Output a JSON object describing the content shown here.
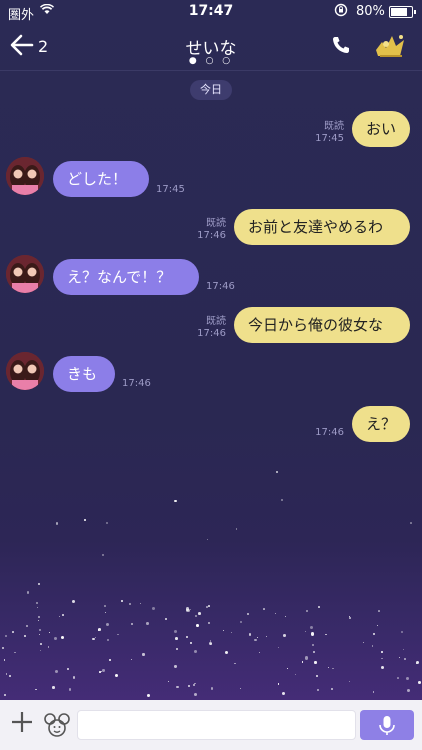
{
  "status_bar": {
    "carrier": "圏外",
    "time": "17:47",
    "battery_percent": "80%",
    "battery_level": 0.8,
    "icons": [
      "wifi-icon",
      "rotation-lock-icon",
      "battery-icon"
    ]
  },
  "header": {
    "back_count": "2",
    "title": "せいな",
    "page_dots": "● ○ ○",
    "icons": [
      "back-arrow-icon",
      "phone-icon",
      "profile-avatar"
    ]
  },
  "date_chip": "今日",
  "messages": [
    {
      "side": "right",
      "text": "おい",
      "read": "既読",
      "time": "17:45"
    },
    {
      "side": "left",
      "text": "どした！",
      "time": "17:45"
    },
    {
      "side": "right",
      "text": "お前と友達やめるわ",
      "read": "既読",
      "time": "17:46"
    },
    {
      "side": "left",
      "text": "え？なんで！？",
      "time": "17:46"
    },
    {
      "side": "right",
      "text": "今日から俺の彼女な",
      "read": "既読",
      "time": "17:46"
    },
    {
      "side": "left",
      "text": "きも",
      "time": "17:46"
    },
    {
      "side": "right",
      "text": "え？",
      "time": "17:46"
    }
  ],
  "input_bar": {
    "placeholder": "",
    "icons": [
      "plus-icon",
      "sticker-icon",
      "mic-icon"
    ]
  },
  "colors": {
    "background": "#2a2852",
    "right_bubble": "#efe08c",
    "left_bubble": "#8c7ee8",
    "meta_text": "#9d9bc6",
    "mic_button": "#8e80e6"
  }
}
